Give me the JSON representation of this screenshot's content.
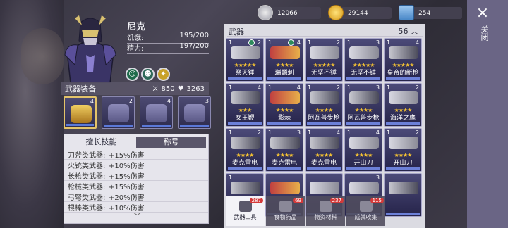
{
  "character": {
    "name": "尼克",
    "hunger_label": "饥饿:",
    "hunger_value": "195/200",
    "energy_label": "精力:",
    "energy_value": "197/200"
  },
  "equipment": {
    "title": "武器装备",
    "attack": "850",
    "defense": "3263",
    "slots": [
      {
        "count": "4"
      },
      {
        "count": "2"
      },
      {
        "count": "4"
      },
      {
        "count": "3"
      }
    ]
  },
  "skills": {
    "tabs": [
      "擅长技能",
      "称号"
    ],
    "rows": [
      {
        "k": "刀斧类武器:",
        "v": "+15%伤害"
      },
      {
        "k": "火铳类武器:",
        "v": "+10%伤害"
      },
      {
        "k": "长枪类武器:",
        "v": "+15%伤害"
      },
      {
        "k": "枪械类武器:",
        "v": "+15%伤害"
      },
      {
        "k": "弓弩类武器:",
        "v": "+20%伤害"
      },
      {
        "k": "棍棒类武器:",
        "v": "+10%伤害"
      }
    ]
  },
  "currency": {
    "silver": "12066",
    "gold": "29144",
    "ticket": "254"
  },
  "weapons_panel": {
    "title": "武器",
    "count": "56",
    "items": [
      {
        "lv": "1",
        "cnt": "2",
        "stars": "★★★★★",
        "name": "祭天锤",
        "art": "a-silver",
        "g": true
      },
      {
        "lv": "1",
        "cnt": "4",
        "stars": "★★★★",
        "name": "瑞麟刺",
        "art": "a-red",
        "g": true
      },
      {
        "lv": "1",
        "cnt": "2",
        "stars": "★★★★★",
        "name": "无坚不锤",
        "art": "a-silver",
        "g": false
      },
      {
        "lv": "1",
        "cnt": "3",
        "stars": "★★★★★",
        "name": "无坚不锤",
        "art": "a-silver",
        "g": false
      },
      {
        "lv": "1",
        "cnt": "4",
        "stars": "★★★★★",
        "name": "皇帝的新枪",
        "art": "a-dark",
        "g": false
      },
      {
        "lv": "1",
        "cnt": "4",
        "stars": "★★★",
        "name": "女王鞭",
        "art": "a-dark",
        "g": false
      },
      {
        "lv": "1",
        "cnt": "4",
        "stars": "★★★★",
        "name": "影棘",
        "art": "a-red",
        "g": false
      },
      {
        "lv": "1",
        "cnt": "2",
        "stars": "★★★★",
        "name": "阿瓦普步枪",
        "art": "a-dark",
        "g": false
      },
      {
        "lv": "1",
        "cnt": "3",
        "stars": "★★★★",
        "name": "阿瓦普步枪",
        "art": "a-dark",
        "g": false
      },
      {
        "lv": "1",
        "cnt": "2",
        "stars": "★★★★",
        "name": "海洋之鹰",
        "art": "a-silver",
        "g": false
      },
      {
        "lv": "1",
        "cnt": "2",
        "stars": "★★★★",
        "name": "麦克雷电",
        "art": "a-dark",
        "g": false
      },
      {
        "lv": "1",
        "cnt": "3",
        "stars": "★★★★",
        "name": "麦克雷电",
        "art": "a-dark",
        "g": false
      },
      {
        "lv": "1",
        "cnt": "4",
        "stars": "★★★★",
        "name": "麦克雷电",
        "art": "a-dark",
        "g": false
      },
      {
        "lv": "1",
        "cnt": "4",
        "stars": "★★★★",
        "name": "开山刀",
        "art": "a-silver",
        "g": false
      },
      {
        "lv": "1",
        "cnt": "2",
        "stars": "★★★★",
        "name": "开山刀",
        "art": "a-silver",
        "g": false
      },
      {
        "lv": "1",
        "cnt": "",
        "stars": "",
        "name": "",
        "art": "a-dark",
        "g": false
      },
      {
        "lv": "",
        "cnt": "",
        "stars": "",
        "name": "",
        "art": "a-red",
        "g": false
      },
      {
        "lv": "",
        "cnt": "",
        "stars": "",
        "name": "",
        "art": "a-silver",
        "g": false
      },
      {
        "lv": "",
        "cnt": "3",
        "stars": "",
        "name": "",
        "art": "a-silver",
        "g": false
      },
      {
        "lv": "",
        "cnt": "",
        "stars": "",
        "name": "",
        "art": "a-dark",
        "g": false
      }
    ]
  },
  "bottom_tabs": [
    {
      "label": "武器工具",
      "badge": "287"
    },
    {
      "label": "食物药品",
      "badge": "69"
    },
    {
      "label": "物资材料",
      "badge": "237"
    },
    {
      "label": "成就收集",
      "badge": "115"
    }
  ],
  "close": {
    "label": "关闭",
    "icon": "×"
  }
}
